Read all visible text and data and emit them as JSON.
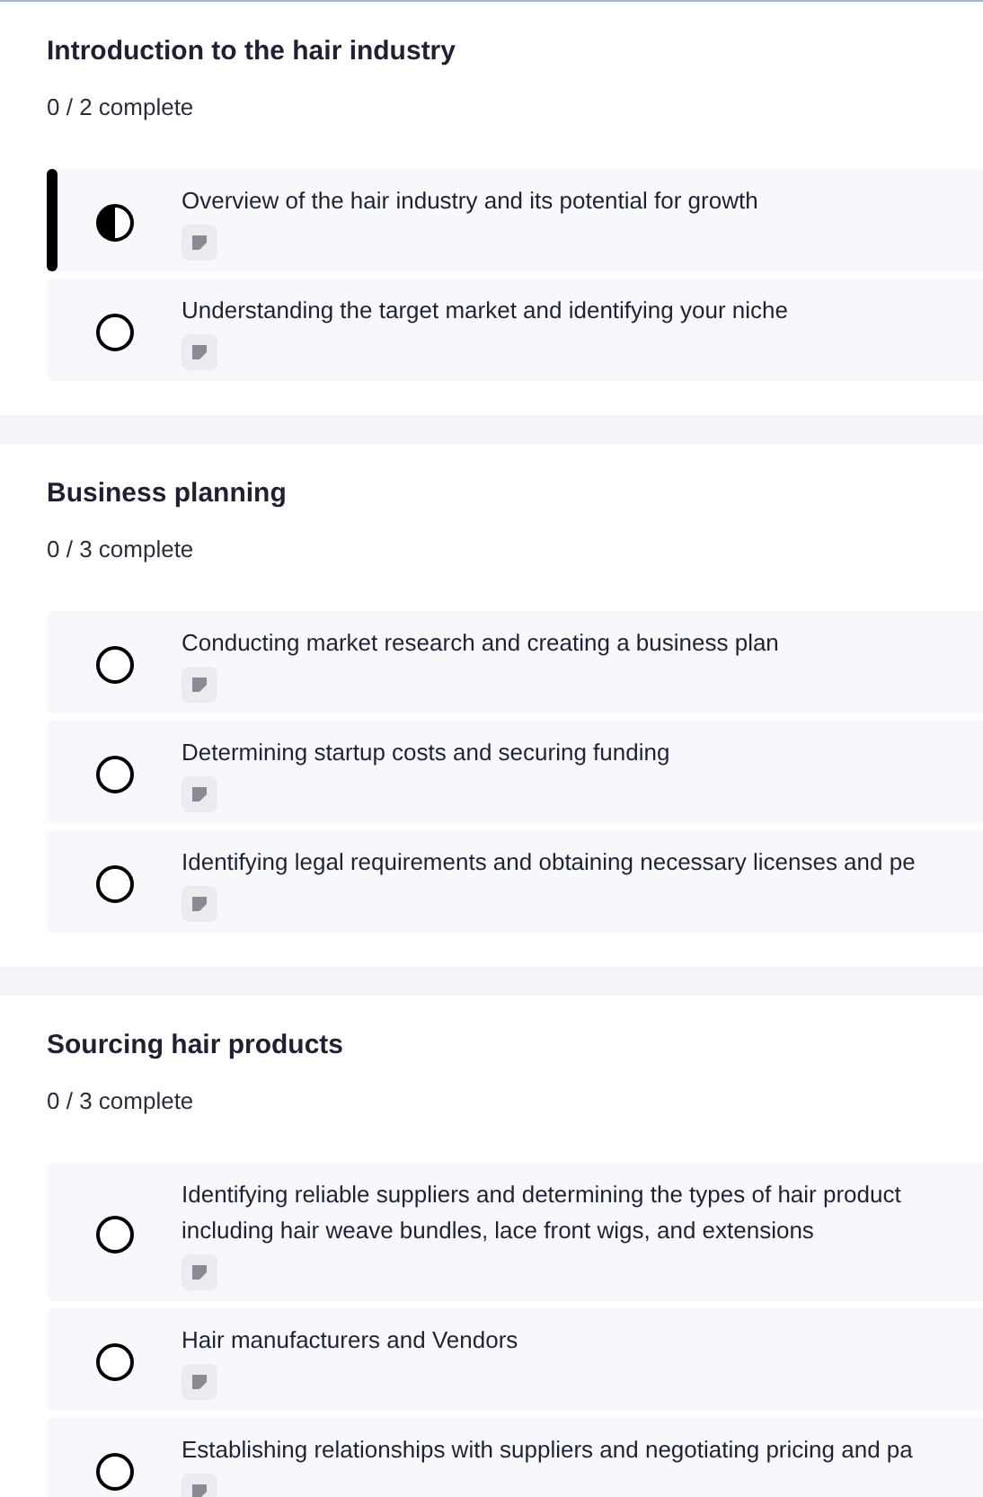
{
  "sections": [
    {
      "title": "Introduction to the hair industry",
      "progress": "0 / 2 complete",
      "lessons": [
        {
          "title": "Overview of the hair industry and its potential for growth",
          "kind": "half",
          "selected": true
        },
        {
          "title": "Understanding the target market and identifying your niche",
          "kind": "empty",
          "selected": false
        }
      ]
    },
    {
      "title": "Business planning",
      "progress": "0 / 3 complete",
      "lessons": [
        {
          "title": "Conducting market research and creating a business plan",
          "kind": "empty",
          "selected": false
        },
        {
          "title": "Determining startup costs and securing funding",
          "kind": "empty",
          "selected": false
        },
        {
          "title": "Identifying legal requirements and obtaining necessary licenses and pe",
          "kind": "empty",
          "selected": false
        }
      ]
    },
    {
      "title": "Sourcing hair products",
      "progress": "0 / 3 complete",
      "lessons": [
        {
          "title": "Identifying reliable suppliers and determining the types of hair product\nincluding hair weave bundles, lace front wigs, and extensions",
          "kind": "empty",
          "selected": false
        },
        {
          "title": "Hair manufacturers and Vendors",
          "kind": "empty",
          "selected": false
        },
        {
          "title": "Establishing relationships with suppliers and negotiating pricing and pa",
          "kind": "empty",
          "selected": false
        }
      ]
    }
  ]
}
